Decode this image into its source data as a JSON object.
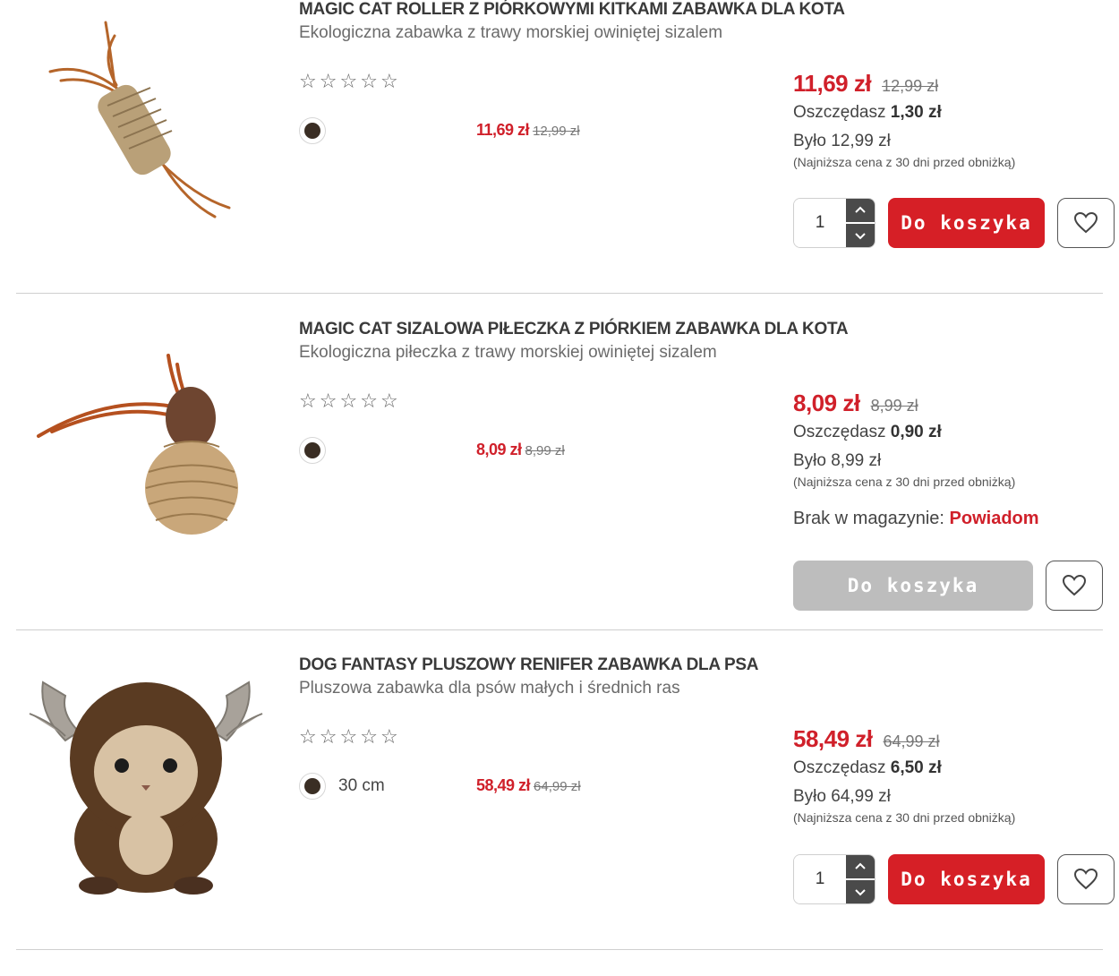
{
  "products": [
    {
      "name": "MAGIC CAT ROLLER Z PIÓRKOWYMI KITKAMI ZABAWKA DLA KOTA",
      "description": "Ekologiczna zabawka z trawy morskiej owiniętej sizalem",
      "rating": 0,
      "variant": {
        "label": "",
        "color": "#3a2e24"
      },
      "row_price": {
        "now": "11,69 zł",
        "old": "12,99 zł"
      },
      "price": "11,69 zł",
      "old_price": "12,99 zł",
      "save_label": "Oszczędasz",
      "save_value": "1,30 zł",
      "was": "Było 12,99 zł",
      "lowest_note": "(Najniższa cena z 30 dni przed obniżką)",
      "quantity": "1",
      "cart_label": "Do koszyka",
      "in_stock": true
    },
    {
      "name": "MAGIC CAT SIZALOWA PIŁECZKA Z PIÓRKIEM ZABAWKA DLA KOTA",
      "description": "Ekologiczna piłeczka z trawy morskiej owiniętej sizalem",
      "rating": 0,
      "variant": {
        "label": "",
        "color": "#3a2e24"
      },
      "row_price": {
        "now": "8,09 zł",
        "old": "8,99 zł"
      },
      "price": "8,09 zł",
      "old_price": "8,99 zł",
      "save_label": "Oszczędasz",
      "save_value": "0,90 zł",
      "was": "Było 8,99 zł",
      "lowest_note": "(Najniższa cena z 30 dni przed obniżką)",
      "stock_label": "Brak w magazynie:",
      "notify_label": "Powiadom",
      "cart_label": "Do koszyka",
      "in_stock": false
    },
    {
      "name": "DOG FANTASY PLUSZOWY RENIFER ZABAWKA DLA PSA",
      "description": "Pluszowa zabawka dla psów małych i średnich ras",
      "rating": 0,
      "variant": {
        "label": "30 cm",
        "color": "#3a2e24"
      },
      "row_price": {
        "now": "58,49 zł",
        "old": "64,99 zł"
      },
      "price": "58,49 zł",
      "old_price": "64,99 zł",
      "save_label": "Oszczędasz",
      "save_value": "6,50 zł",
      "was": "Było 64,99 zł",
      "lowest_note": "(Najniższa cena z 30 dni przed obniżką)",
      "quantity": "1",
      "cart_label": "Do koszyka",
      "in_stock": true
    }
  ],
  "colors": {
    "accent": "#d61f26",
    "price": "#d0202a",
    "disabled": "#bdbdbd"
  },
  "icons": {
    "rating": "star-outline-icon",
    "wishlist": "heart-outline-icon",
    "qty_up": "chevron-up-icon",
    "qty_down": "chevron-down-icon"
  }
}
